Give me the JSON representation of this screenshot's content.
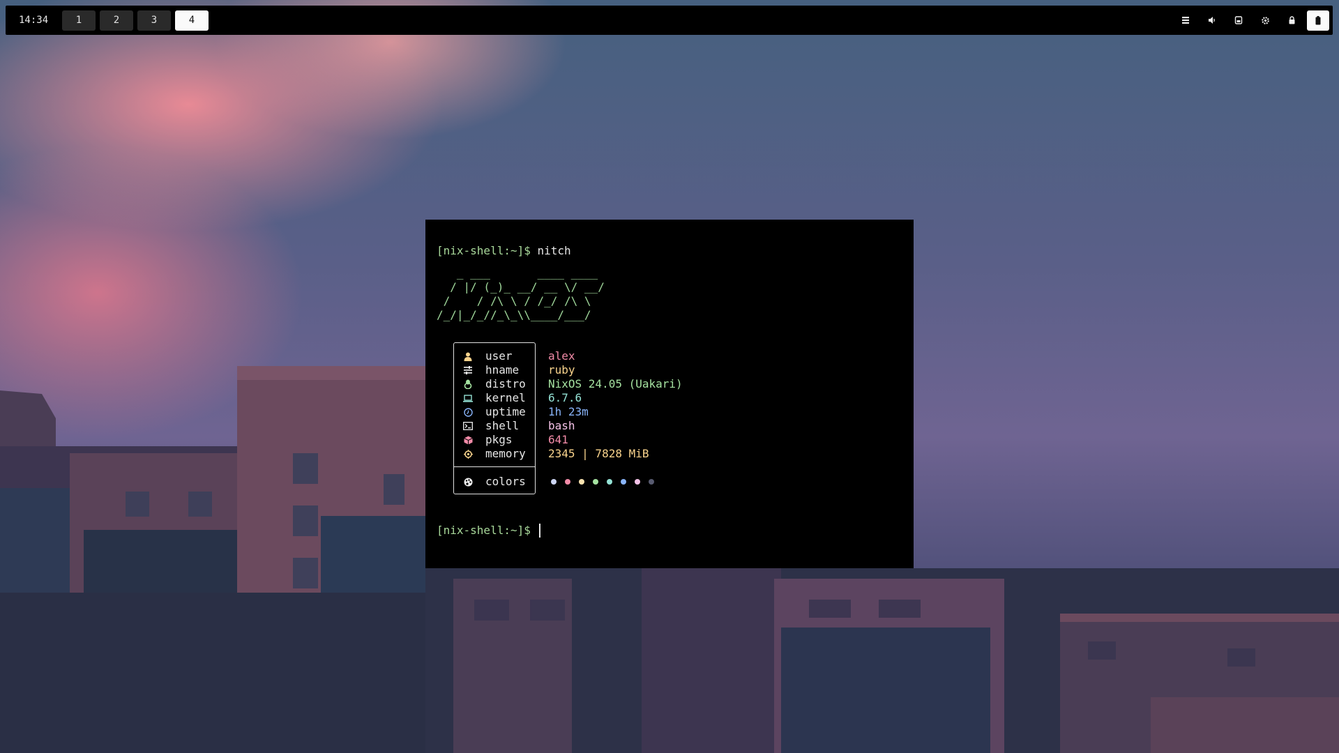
{
  "topbar": {
    "clock": "14:34",
    "workspaces": [
      {
        "label": "1",
        "active": false
      },
      {
        "label": "2",
        "active": false
      },
      {
        "label": "3",
        "active": false
      },
      {
        "label": "4",
        "active": true
      }
    ],
    "tray_icons": [
      "menu-icon",
      "volume-icon",
      "screenshot-icon",
      "settings-icon",
      "lock-icon",
      "battery-icon"
    ]
  },
  "terminal": {
    "prompt": "[nix-shell:~]$",
    "command": "nitch",
    "ascii_art": "   _ ___       ____ ____\n  / |/ (_)_ __/ __ \\/ __/\n /    / /\\ \\ / /_/ /\\ \\\n/_/|_/_//_\\_\\\\____/___/",
    "fetch": [
      {
        "key": "user",
        "value": "alex",
        "icon": "user-icon",
        "color": "#f38ba8"
      },
      {
        "key": "hname",
        "value": "ruby",
        "icon": "hostname-icon",
        "color": "#f9d38c"
      },
      {
        "key": "distro",
        "value": "NixOS 24.05 (Uakari)",
        "icon": "linux-icon",
        "color": "#a6e3a1"
      },
      {
        "key": "kernel",
        "value": "6.7.6",
        "icon": "laptop-icon",
        "color": "#94e2d5"
      },
      {
        "key": "uptime",
        "value": "1h 23m",
        "icon": "clock-icon",
        "color": "#89b4fa"
      },
      {
        "key": "shell",
        "value": "bash",
        "icon": "terminal-icon",
        "color": "#f5c2e7"
      },
      {
        "key": "pkgs",
        "value": "641",
        "icon": "package-icon",
        "color": "#f38ba8"
      },
      {
        "key": "memory",
        "value": "2345 | 7828 MiB",
        "icon": "memory-icon",
        "color": "#f9d38c"
      }
    ],
    "colors_key": "colors",
    "palette": [
      "#cdd6f4",
      "#f38ba8",
      "#f9e2af",
      "#a6e3a1",
      "#94e2d5",
      "#89b4fa",
      "#f5c2e7",
      "#585b70"
    ]
  }
}
